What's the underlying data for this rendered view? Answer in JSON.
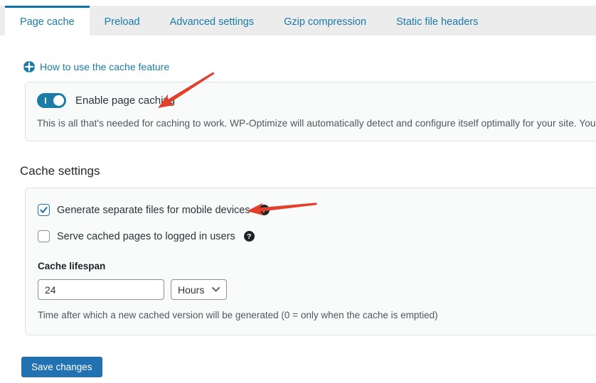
{
  "tabs": [
    {
      "label": "Page cache",
      "active": true
    },
    {
      "label": "Preload",
      "active": false
    },
    {
      "label": "Advanced settings",
      "active": false
    },
    {
      "label": "Gzip compression",
      "active": false
    },
    {
      "label": "Static file headers",
      "active": false
    }
  ],
  "help_link": {
    "label": "How to use the cache feature",
    "icon": "life-ring-icon"
  },
  "enable_caching": {
    "label": "Enable page caching",
    "enabled": true,
    "description": "This is all that's needed for caching to work. WP-Optimize will automatically detect and configure itself optimally for your site. You can twe"
  },
  "cache_settings": {
    "heading": "Cache settings",
    "checkboxes": [
      {
        "label": "Generate separate files for mobile devices",
        "checked": true,
        "help_icon": "?"
      },
      {
        "label": "Serve cached pages to logged in users",
        "checked": false,
        "help_icon": "?"
      }
    ],
    "cache_lifespan": {
      "label": "Cache lifespan",
      "value": "24",
      "unit": "Hours",
      "help_text": "Time after which a new cached version will be generated (0 = only when the cache is emptied)"
    }
  },
  "save_button": {
    "label": "Save changes"
  },
  "annotations": [
    {
      "type": "arrow",
      "points_at": "enable-page-caching-label"
    },
    {
      "type": "arrow",
      "points_at": "mobile-devices-help-icon"
    }
  ],
  "colors": {
    "accent_blue": "#1a7aa8",
    "toggle_blue": "#1c7ca8",
    "button_blue": "#2271b1",
    "tabbar_gray": "#ececec",
    "panel_bg": "#f9fafa",
    "panel_border": "#e0e3e6",
    "text_dark": "#2c3338",
    "text_gray": "#50575e",
    "annotation_red": "#e2402c",
    "help_icon_bg": "#1d2327"
  }
}
